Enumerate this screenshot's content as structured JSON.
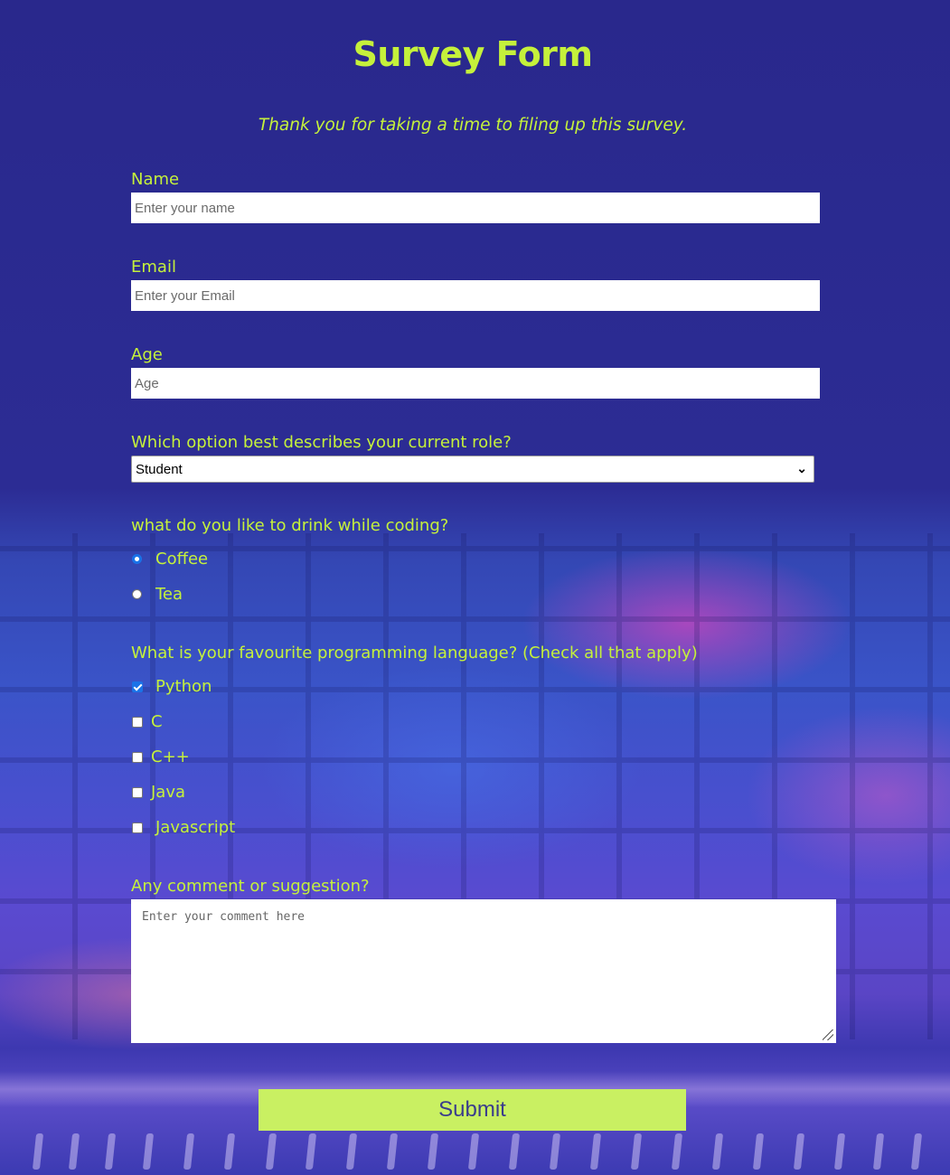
{
  "header": {
    "title": "Survey Form",
    "description": "Thank you for taking a time to filing up this survey."
  },
  "fields": {
    "name": {
      "label": "Name",
      "placeholder": "Enter your name"
    },
    "email": {
      "label": "Email",
      "placeholder": "Enter your Email"
    },
    "age": {
      "label": "Age",
      "placeholder": "Age"
    }
  },
  "role": {
    "label": "Which option best describes your current role?",
    "selected": "Student"
  },
  "drink": {
    "label": "what do you like to drink while coding?",
    "options": [
      {
        "label": "Coffee",
        "selected": true
      },
      {
        "label": "Tea",
        "selected": false
      }
    ]
  },
  "languages": {
    "label": "What is your favourite programming language? (Check all that apply)",
    "options": [
      {
        "label": "Python",
        "checked": true
      },
      {
        "label": "C",
        "checked": false
      },
      {
        "label": "C++",
        "checked": false
      },
      {
        "label": "Java",
        "checked": false
      },
      {
        "label": "Javascript",
        "checked": false
      }
    ]
  },
  "comment": {
    "label": "Any comment or suggestion?",
    "placeholder": "Enter your comment here"
  },
  "submit": {
    "label": "Submit"
  },
  "colors": {
    "text_accent": "#c5f13b",
    "button_bg": "#c9f062",
    "button_text": "#3a3c8c",
    "background_top": "#29288c"
  }
}
